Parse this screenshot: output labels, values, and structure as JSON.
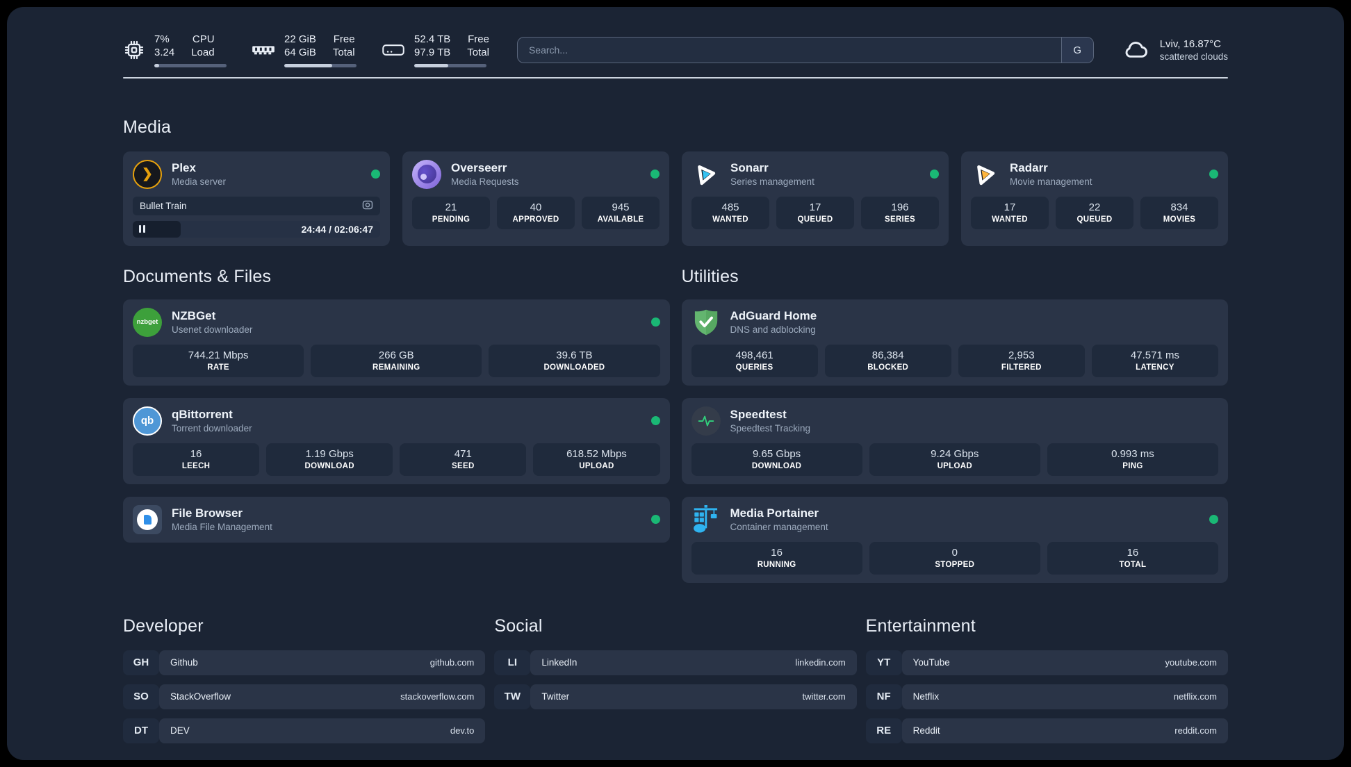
{
  "header": {
    "system_stats": [
      {
        "icon": "cpu-icon",
        "values": [
          "7%",
          "3.24"
        ],
        "labels": [
          "CPU",
          "Load"
        ],
        "progress_pct": 7
      },
      {
        "icon": "memory-icon",
        "values": [
          "22 GiB",
          "64 GiB"
        ],
        "labels": [
          "Free",
          "Total"
        ],
        "progress_pct": 66
      },
      {
        "icon": "disk-icon",
        "values": [
          "52.4 TB",
          "97.9 TB"
        ],
        "labels": [
          "Free",
          "Total"
        ],
        "progress_pct": 47
      }
    ],
    "search": {
      "placeholder": "Search...",
      "provider_button": "G"
    },
    "weather": {
      "location_temp": "Lviv, 16.87°C",
      "condition": "scattered clouds"
    }
  },
  "colors": {
    "status_online": "#1ab875"
  },
  "sections": {
    "media": {
      "title": "Media",
      "plex": {
        "title": "Plex",
        "subtitle": "Media server",
        "now_playing": "Bullet Train",
        "time": "24:44 / 02:06:47",
        "progress_pct": 19.5
      },
      "overseerr": {
        "title": "Overseerr",
        "subtitle": "Media Requests",
        "stats": [
          {
            "value": "21",
            "label": "PENDING"
          },
          {
            "value": "40",
            "label": "APPROVED"
          },
          {
            "value": "945",
            "label": "AVAILABLE"
          }
        ]
      },
      "sonarr": {
        "title": "Sonarr",
        "subtitle": "Series management",
        "stats": [
          {
            "value": "485",
            "label": "WANTED"
          },
          {
            "value": "17",
            "label": "QUEUED"
          },
          {
            "value": "196",
            "label": "SERIES"
          }
        ]
      },
      "radarr": {
        "title": "Radarr",
        "subtitle": "Movie management",
        "stats": [
          {
            "value": "17",
            "label": "WANTED"
          },
          {
            "value": "22",
            "label": "QUEUED"
          },
          {
            "value": "834",
            "label": "MOVIES"
          }
        ]
      }
    },
    "documents": {
      "title": "Documents & Files",
      "nzbget": {
        "title": "NZBGet",
        "subtitle": "Usenet downloader",
        "stats": [
          {
            "value": "744.21 Mbps",
            "label": "RATE"
          },
          {
            "value": "266 GB",
            "label": "REMAINING"
          },
          {
            "value": "39.6 TB",
            "label": "DOWNLOADED"
          }
        ]
      },
      "qbittorrent": {
        "title": "qBittorrent",
        "subtitle": "Torrent downloader",
        "stats": [
          {
            "value": "16",
            "label": "LEECH"
          },
          {
            "value": "1.19 Gbps",
            "label": "DOWNLOAD"
          },
          {
            "value": "471",
            "label": "SEED"
          },
          {
            "value": "618.52 Mbps",
            "label": "UPLOAD"
          }
        ]
      },
      "filebrowser": {
        "title": "File Browser",
        "subtitle": "Media File Management"
      }
    },
    "utilities": {
      "title": "Utilities",
      "adguard": {
        "title": "AdGuard Home",
        "subtitle": "DNS and adblocking",
        "stats": [
          {
            "value": "498,461",
            "label": "QUERIES"
          },
          {
            "value": "86,384",
            "label": "BLOCKED"
          },
          {
            "value": "2,953",
            "label": "FILTERED"
          },
          {
            "value": "47.571 ms",
            "label": "LATENCY"
          }
        ]
      },
      "speedtest": {
        "title": "Speedtest",
        "subtitle": "Speedtest Tracking",
        "stats": [
          {
            "value": "9.65 Gbps",
            "label": "DOWNLOAD"
          },
          {
            "value": "9.24 Gbps",
            "label": "UPLOAD"
          },
          {
            "value": "0.993 ms",
            "label": "PING"
          }
        ]
      },
      "portainer": {
        "title": "Media Portainer",
        "subtitle": "Container management",
        "stats": [
          {
            "value": "16",
            "label": "RUNNING"
          },
          {
            "value": "0",
            "label": "STOPPED"
          },
          {
            "value": "16",
            "label": "TOTAL"
          }
        ]
      }
    },
    "bookmarks": [
      {
        "title": "Developer",
        "links": [
          {
            "abbr": "GH",
            "name": "Github",
            "url": "github.com"
          },
          {
            "abbr": "SO",
            "name": "StackOverflow",
            "url": "stackoverflow.com"
          },
          {
            "abbr": "DT",
            "name": "DEV",
            "url": "dev.to"
          }
        ]
      },
      {
        "title": "Social",
        "links": [
          {
            "abbr": "LI",
            "name": "LinkedIn",
            "url": "linkedin.com"
          },
          {
            "abbr": "TW",
            "name": "Twitter",
            "url": "twitter.com"
          }
        ]
      },
      {
        "title": "Entertainment",
        "links": [
          {
            "abbr": "YT",
            "name": "YouTube",
            "url": "youtube.com"
          },
          {
            "abbr": "NF",
            "name": "Netflix",
            "url": "netflix.com"
          },
          {
            "abbr": "RE",
            "name": "Reddit",
            "url": "reddit.com"
          }
        ]
      }
    ]
  }
}
